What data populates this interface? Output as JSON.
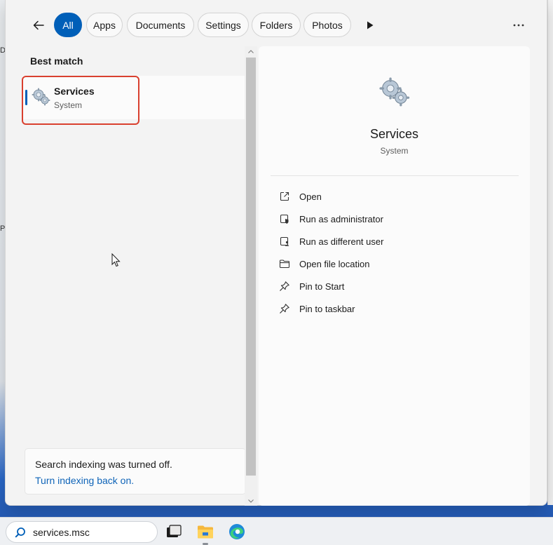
{
  "filters": {
    "back_icon": "back-arrow-icon",
    "chips": [
      "All",
      "Apps",
      "Documents",
      "Settings",
      "Folders",
      "Photos"
    ],
    "active": "All",
    "more_icon": "play-arrow-icon",
    "options_icon": "ellipsis-icon"
  },
  "results": {
    "section_label": "Best match",
    "best_match": {
      "title": "Services",
      "subtitle": "System",
      "icon": "services-gear-icon"
    }
  },
  "indexing": {
    "message": "Search indexing was turned off.",
    "link": "Turn indexing back on."
  },
  "preview": {
    "title": "Services",
    "subtitle": "System",
    "actions": [
      {
        "label": "Open",
        "icon": "open-external-icon"
      },
      {
        "label": "Run as administrator",
        "icon": "shield-run-icon"
      },
      {
        "label": "Run as different user",
        "icon": "user-run-icon"
      },
      {
        "label": "Open file location",
        "icon": "folder-icon"
      },
      {
        "label": "Pin to Start",
        "icon": "pin-icon"
      },
      {
        "label": "Pin to taskbar",
        "icon": "pin-icon"
      }
    ]
  },
  "taskbar": {
    "search_value": "services.msc",
    "apps": [
      "task-view-icon",
      "file-explorer-icon",
      "edge-browser-icon"
    ]
  },
  "colors": {
    "accent": "#005fb8",
    "highlight_border": "#d9402f",
    "link": "#0f64b8"
  }
}
